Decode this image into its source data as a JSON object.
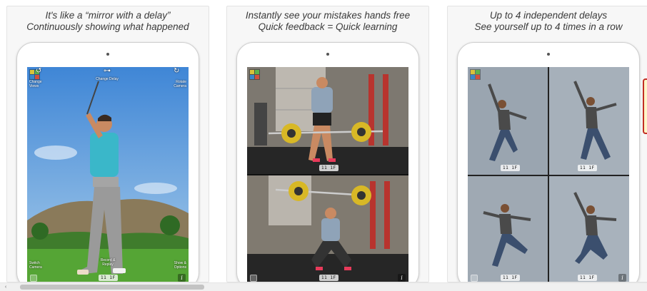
{
  "panels": [
    {
      "id": "mirror",
      "caption_line1": "It's like a “mirror with a delay”",
      "caption_line2": "Continuously showing what happened",
      "timers": [
        "11 1F"
      ],
      "labels": {
        "top_left": "Change Views",
        "top_center": "Change Delay",
        "top_right": "Rotate Camera",
        "bottom_left": "Switch Camera",
        "bottom_center": "Record & Replay",
        "bottom_right": "Show & Options"
      }
    },
    {
      "id": "weightlifting",
      "caption_line1": "Instantly see your mistakes hands free",
      "caption_line2": "Quick feedback = Quick learning",
      "timers": [
        "11 1F",
        "11 1F"
      ]
    },
    {
      "id": "dance",
      "caption_line1": "Up to 4 independent delays",
      "caption_line2": "See yourself up to 4 times in a row",
      "timers": [
        "11 1F",
        "11 1F",
        "11 1F",
        "11 1F"
      ]
    }
  ],
  "colors": {
    "accent_outline": "#c22f24",
    "accent_fill": "#fff6c8",
    "sky": "#4a8fd8",
    "grass": "#4f9a2e"
  },
  "icons": {
    "grid": "grid-view-icon",
    "info": "info-icon",
    "rotate": "rotate-camera-icon",
    "scroll_left": "scroll-left-arrow-icon"
  },
  "scrollbar": {
    "arrow": "‹"
  }
}
